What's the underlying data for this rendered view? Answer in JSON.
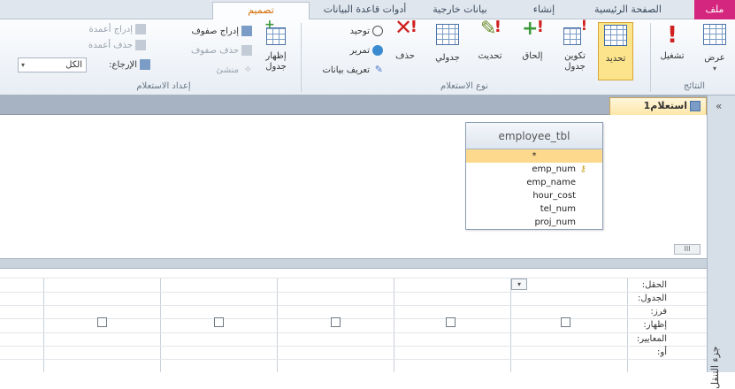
{
  "tabs": {
    "file": "ملف",
    "home": "الصفحة الرئيسية",
    "create": "إنشاء",
    "external": "بيانات خارجية",
    "dbtools": "أدوات قاعدة البيانات",
    "design": "تصميم"
  },
  "ribbon": {
    "results": {
      "view": "عرض",
      "run": "تشغيل",
      "label": "النتائج"
    },
    "query_type": {
      "select": "تحديد",
      "make_table_l1": "تكوين",
      "make_table_l2": "جدول",
      "append": "إلحاق",
      "update": "تحديث",
      "crosstab": "جدولي",
      "delete": "حذف",
      "union": "توحيد",
      "pass_through": "تمرير",
      "data_definition": "تعريف بيانات",
      "label": "نوع الاستعلام"
    },
    "setup": {
      "show_table_l1": "إظهار",
      "show_table_l2": "جدول",
      "insert_rows": "إدراج صفوف",
      "delete_rows": "حذف صفوف",
      "builder": "منشئ",
      "insert_columns": "إدراج أعمدة",
      "delete_columns": "حذف أعمدة",
      "return_label": "الإرجاع:",
      "return_value": "الكل",
      "label": "إعداد الاستعلام"
    }
  },
  "document": {
    "tab_title": "استعلام1"
  },
  "table": {
    "name": "employee_tbl",
    "star": "*",
    "fields": [
      "emp_num",
      "emp_name",
      "hour_cost",
      "tel_num",
      "proj_num"
    ]
  },
  "grid": {
    "row_labels": [
      "الحقل:",
      "الجدول:",
      "فرز:",
      "إظهار:",
      "المعايير:",
      "أو:"
    ]
  },
  "nav_pane": {
    "label": "جزء التنقل"
  },
  "scroll_label": "III"
}
